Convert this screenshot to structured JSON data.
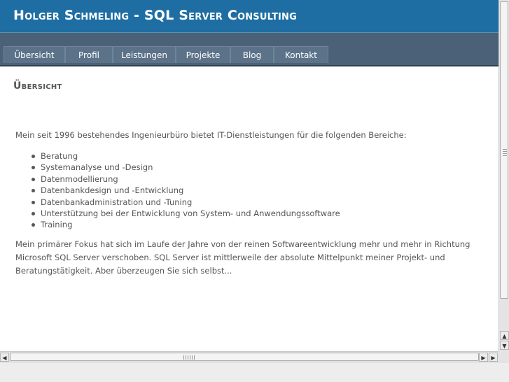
{
  "header": {
    "title": "Holger Schmeling - SQL Server Consulting"
  },
  "nav": {
    "items": [
      {
        "label": "Übersicht",
        "name": "nav-item-uebersicht"
      },
      {
        "label": "Profil",
        "name": "nav-item-profil"
      },
      {
        "label": "Leistungen",
        "name": "nav-item-leistungen"
      },
      {
        "label": "Projekte",
        "name": "nav-item-projekte"
      },
      {
        "label": "Blog",
        "name": "nav-item-blog"
      },
      {
        "label": "Kontakt",
        "name": "nav-item-kontakt"
      }
    ]
  },
  "main": {
    "title": "Übersicht",
    "intro": "Mein seit 1996 bestehendes Ingenieurbüro bietet IT-Dienstleistungen für die folgenden Bereiche:",
    "services": [
      "Beratung",
      "Systemanalyse und -Design",
      "Datenmodellierung",
      "Datenbankdesign und -Entwicklung",
      "Datenbankadministration und -Tuning",
      "Unterstützung bei der Entwicklung von System- und Anwendungssoftware",
      "Training"
    ],
    "focus": "Mein primärer Fokus hat sich im Laufe der Jahre von der reinen Softwareentwicklung mehr und mehr in Richtung Microsoft SQL Server verschoben. SQL Server ist mittlerweile der absolute Mittelpunkt meiner Projekt- und Beratungstätigkeit. Aber überzeugen Sie sich selbst..."
  },
  "scrollbars": {
    "up_arrow": "▲",
    "down_arrow": "▼",
    "left_arrow": "◀",
    "right_arrow": "▶"
  },
  "colors": {
    "header_bg": "#1f6ea3",
    "nav_bg": "#4a6178",
    "nav_item_bg": "#5b7289"
  }
}
